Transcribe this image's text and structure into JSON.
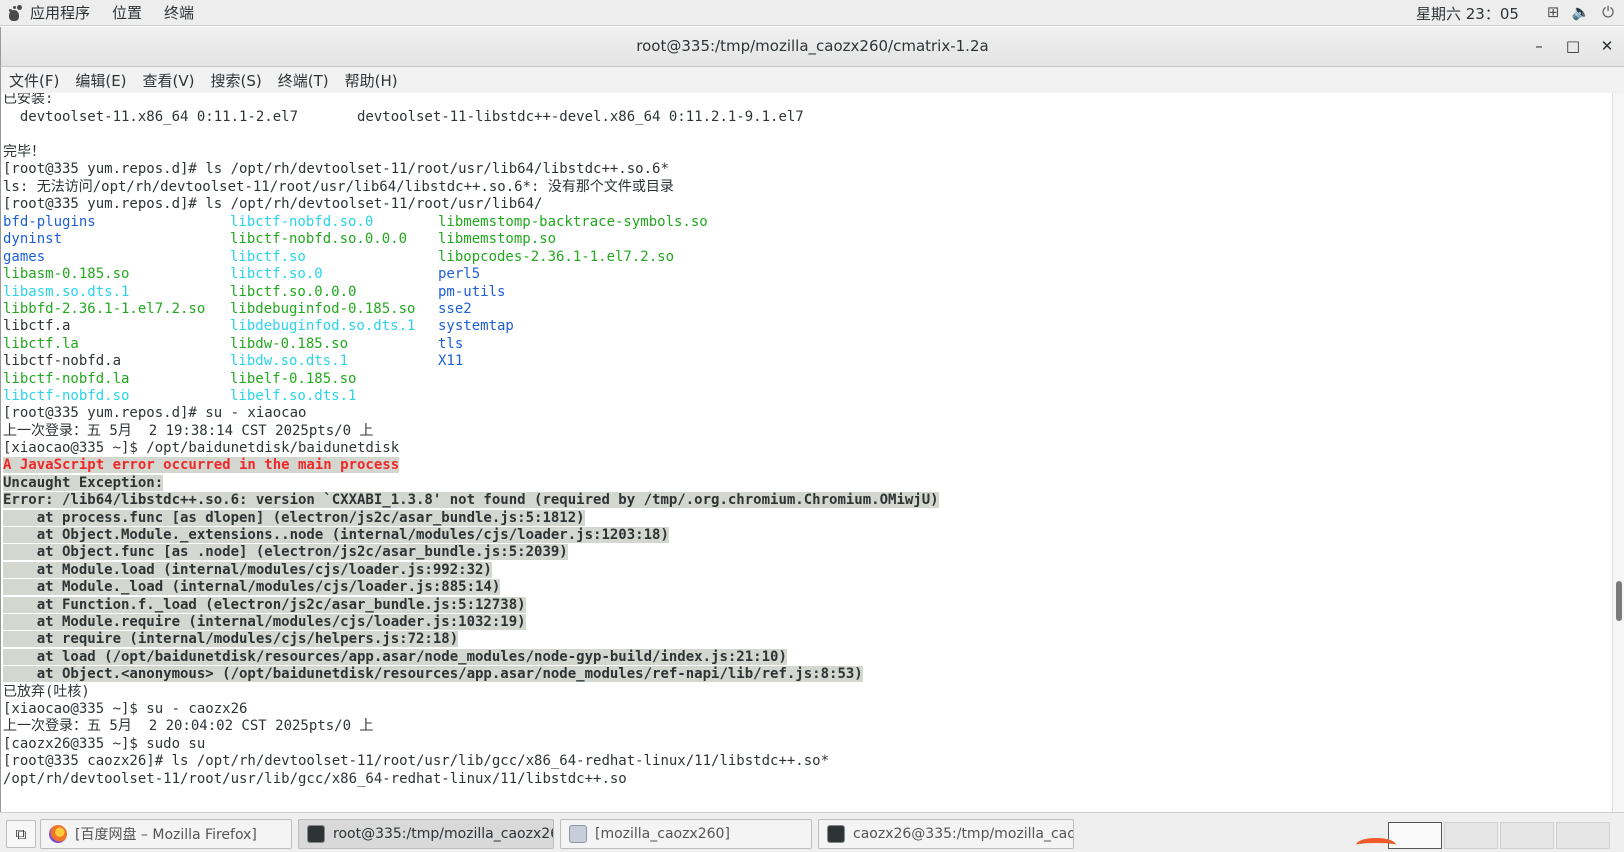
{
  "top_panel": {
    "menus": [
      "应用程序",
      "位置",
      "终端"
    ],
    "clock": "星期六 23：05",
    "tray_icons": [
      "network-icon",
      "volume-icon",
      "power-icon"
    ]
  },
  "window": {
    "title": "root@335:/tmp/mozilla_caozx260/cmatrix-1.2a",
    "buttons": {
      "minimize": "–",
      "maximize": "□",
      "close": "✕"
    }
  },
  "menubar": [
    "文件(F)",
    "编辑(E)",
    "查看(V)",
    "搜索(S)",
    "终端(T)",
    "帮助(H)"
  ],
  "terminal": {
    "plain_lines": {
      "l0": "已安装:",
      "l1": "  devtoolset-11.x86_64 0:11.1-2.el7       devtoolset-11-libstdc++-devel.x86_64 0:11.2.1-9.1.el7",
      "l3": "完毕！",
      "l4": "[root@335 yum.repos.d]# ls /opt/rh/devtoolset-11/root/usr/lib64/libstdc++.so.6*",
      "l5": "ls: 无法访问/opt/rh/devtoolset-11/root/usr/lib64/libstdc++.so.6*: 没有那个文件或目录",
      "l6": "[root@335 yum.repos.d]# ls /opt/rh/devtoolset-11/root/usr/lib64/",
      "l18": "[root@335 yum.repos.d]# su - xiaocao",
      "l19": "上一次登录：五 5月  2 19:38:14 CST 2025pts/0 上",
      "l20": "[xiaocao@335 ~]$ /opt/baidunetdisk/baidunetdisk",
      "l34": "已放弃(吐核)",
      "l35": "[xiaocao@335 ~]$ su - caozx26",
      "l36": "上一次登录：五 5月  2 20:04:02 CST 2025pts/0 上",
      "l37": "[caozx26@335 ~]$ sudo su",
      "l38": "[root@335 caozx26]# ls /opt/rh/devtoolset-11/root/usr/lib/gcc/x86_64-redhat-linux/11/libstdc++.so*",
      "l39": "/opt/rh/devtoolset-11/root/usr/lib/gcc/x86_64-redhat-linux/11/libstdc++.so"
    },
    "ls_listing": [
      [
        "bfd-plugins",
        "libctf-nobfd.so.0",
        "libmemstomp-backtrace-symbols.so"
      ],
      [
        "dyninst",
        "libctf-nobfd.so.0.0.0",
        "libmemstomp.so"
      ],
      [
        "games",
        "libctf.so",
        "libopcodes-2.36.1-1.el7.2.so"
      ],
      [
        "libasm-0.185.so",
        "libctf.so.0",
        "perl5"
      ],
      [
        "libasm.so.dts.1",
        "libctf.so.0.0.0",
        "pm-utils"
      ],
      [
        "libbfd-2.36.1-1.el7.2.so",
        "libdebuginfod-0.185.so",
        "sse2"
      ],
      [
        "libctf.a",
        "libdebuginfod.so.dts.1",
        "systemtap"
      ],
      [
        "libctf.la",
        "libdw-0.185.so",
        "tls"
      ],
      [
        "libctf-nobfd.a",
        "libdw.so.dts.1",
        "X11"
      ],
      [
        "libctf-nobfd.la",
        "libelf-0.185.so",
        ""
      ],
      [
        "libctf-nobfd.so",
        "libelf.so.dts.1",
        ""
      ]
    ],
    "ls_colors": [
      [
        "blue",
        "cyan",
        "green"
      ],
      [
        "blue",
        "green",
        "green"
      ],
      [
        "blue",
        "cyan",
        "green"
      ],
      [
        "green",
        "cyan",
        "blue"
      ],
      [
        "cyan",
        "green",
        "blue"
      ],
      [
        "green",
        "green",
        "blue"
      ],
      [
        "plain",
        "cyan",
        "blue"
      ],
      [
        "green",
        "green",
        "blue"
      ],
      [
        "plain",
        "cyan",
        "blue"
      ],
      [
        "green",
        "green",
        "plain"
      ],
      [
        "cyan",
        "cyan",
        "plain"
      ]
    ],
    "error_lines": {
      "e0": "A JavaScript error occurred in the main process",
      "e1": "Uncaught Exception:",
      "e2": "Error: /lib64/libstdc++.so.6: version `CXXABI_1.3.8' not found (required by /tmp/.org.chromium.Chromium.OMiwjU)",
      "e3": "    at process.func [as dlopen] (electron/js2c/asar_bundle.js:5:1812)",
      "e4": "    at Object.Module._extensions..node (internal/modules/cjs/loader.js:1203:18)",
      "e5": "    at Object.func [as .node] (electron/js2c/asar_bundle.js:5:2039)",
      "e6": "    at Module.load (internal/modules/cjs/loader.js:992:32)",
      "e7": "    at Module._load (internal/modules/cjs/loader.js:885:14)",
      "e8": "    at Function.f._load (electron/js2c/asar_bundle.js:5:12738)",
      "e9": "    at Module.require (internal/modules/cjs/loader.js:1032:19)",
      "e10": "    at require (internal/modules/cjs/helpers.js:72:18)",
      "e11": "    at load (/opt/baidunetdisk/resources/app.asar/node_modules/node-gyp-build/index.js:21:10)",
      "e12": "    at Object.<anonymous> (/opt/baidunetdisk/resources/app.asar/node_modules/ref-napi/lib/ref.js:8:53)"
    }
  },
  "taskbar": {
    "tasks": [
      {
        "label": "[百度网盘 – Mozilla Firefox]",
        "icon": "firefox-icon"
      },
      {
        "label": "root@335:/tmp/mozilla_caozx260/…",
        "icon": "terminal-icon"
      },
      {
        "label": "[mozilla_caozx260]",
        "icon": "folder-icon"
      },
      {
        "label": "caozx26@335:/tmp/mozilla_caozx…",
        "icon": "terminal-icon"
      }
    ]
  },
  "colors": {
    "ls_dir": "#1e5fd6",
    "ls_link": "#2ad4e8",
    "ls_exec": "#22a81e",
    "error_red": "#ef2929",
    "error_bg": "#d3d7cf"
  }
}
